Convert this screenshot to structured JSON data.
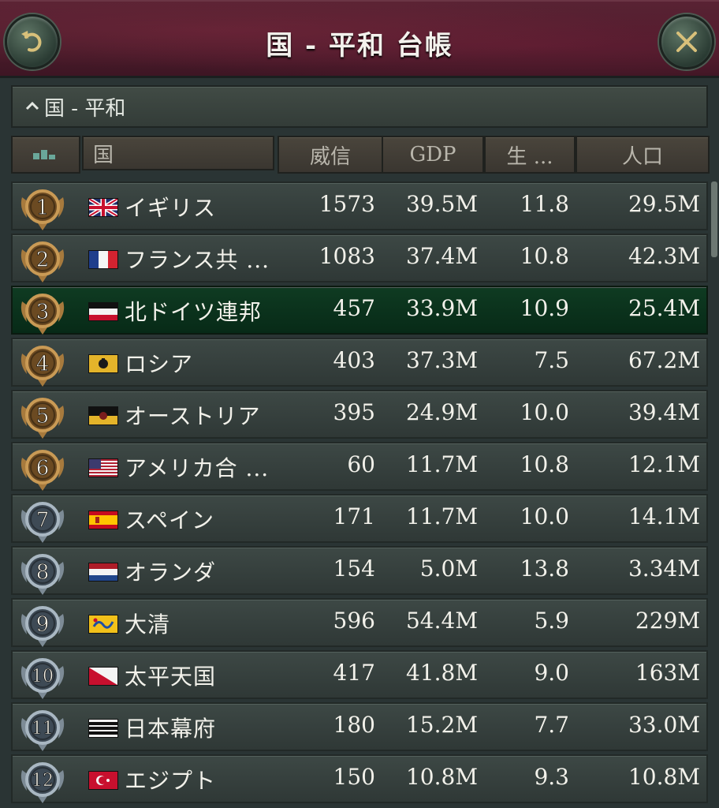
{
  "window": {
    "title": "国 - 平和 台帳",
    "back_icon": "undo-arrow-icon",
    "close_icon": "close-x-icon"
  },
  "group": {
    "label": "国 - 平和",
    "icon": "chevron-up-icon"
  },
  "columns": {
    "icon": "bar-chart-icon",
    "country": "国",
    "prestige": "威信",
    "gdp": "GDP",
    "sol": "生 ...",
    "population": "人口"
  },
  "colors": {
    "gold_medal": "#b88a4e",
    "silver_medal": "#8a9aa8",
    "highlight_row": "#0f3b22",
    "title_bar": "#4a1c2b"
  },
  "rows": [
    {
      "rank": "1",
      "name": "イギリス",
      "prestige": "1573",
      "gdp": "39.5M",
      "sol": "11.8",
      "pop": "29.5M",
      "medal": "gold",
      "flag": "uk-flag-icon"
    },
    {
      "rank": "2",
      "name": "フランス共 ...",
      "prestige": "1083",
      "gdp": "37.4M",
      "sol": "10.8",
      "pop": "42.3M",
      "medal": "gold",
      "flag": "france-flag-icon"
    },
    {
      "rank": "3",
      "name": "北ドイツ連邦",
      "prestige": "457",
      "gdp": "33.9M",
      "sol": "10.9",
      "pop": "25.4M",
      "medal": "gold",
      "flag": "north-germany-flag-icon",
      "selected": true
    },
    {
      "rank": "4",
      "name": "ロシア",
      "prestige": "403",
      "gdp": "37.3M",
      "sol": "7.5",
      "pop": "67.2M",
      "medal": "gold",
      "flag": "russia-flag-icon"
    },
    {
      "rank": "5",
      "name": "オーストリア",
      "prestige": "395",
      "gdp": "24.9M",
      "sol": "10.0",
      "pop": "39.4M",
      "medal": "gold",
      "flag": "austria-flag-icon"
    },
    {
      "rank": "6",
      "name": "アメリカ合 ...",
      "prestige": "60",
      "gdp": "11.7M",
      "sol": "10.8",
      "pop": "12.1M",
      "medal": "gold",
      "flag": "usa-flag-icon"
    },
    {
      "rank": "7",
      "name": "スペイン",
      "prestige": "171",
      "gdp": "11.7M",
      "sol": "10.0",
      "pop": "14.1M",
      "medal": "silver",
      "flag": "spain-flag-icon"
    },
    {
      "rank": "8",
      "name": "オランダ",
      "prestige": "154",
      "gdp": "5.0M",
      "sol": "13.8",
      "pop": "3.34M",
      "medal": "silver",
      "flag": "netherlands-flag-icon"
    },
    {
      "rank": "9",
      "name": "大清",
      "prestige": "596",
      "gdp": "54.4M",
      "sol": "5.9",
      "pop": "229M",
      "medal": "silver",
      "flag": "qing-flag-icon"
    },
    {
      "rank": "10",
      "name": "太平天国",
      "prestige": "417",
      "gdp": "41.8M",
      "sol": "9.0",
      "pop": "163M",
      "medal": "silver",
      "flag": "taiping-flag-icon"
    },
    {
      "rank": "11",
      "name": "日本幕府",
      "prestige": "180",
      "gdp": "15.2M",
      "sol": "7.7",
      "pop": "33.0M",
      "medal": "silver",
      "flag": "shogunate-flag-icon"
    },
    {
      "rank": "12",
      "name": "エジプト",
      "prestige": "150",
      "gdp": "10.8M",
      "sol": "9.3",
      "pop": "10.8M",
      "medal": "silver",
      "flag": "egypt-flag-icon"
    }
  ]
}
